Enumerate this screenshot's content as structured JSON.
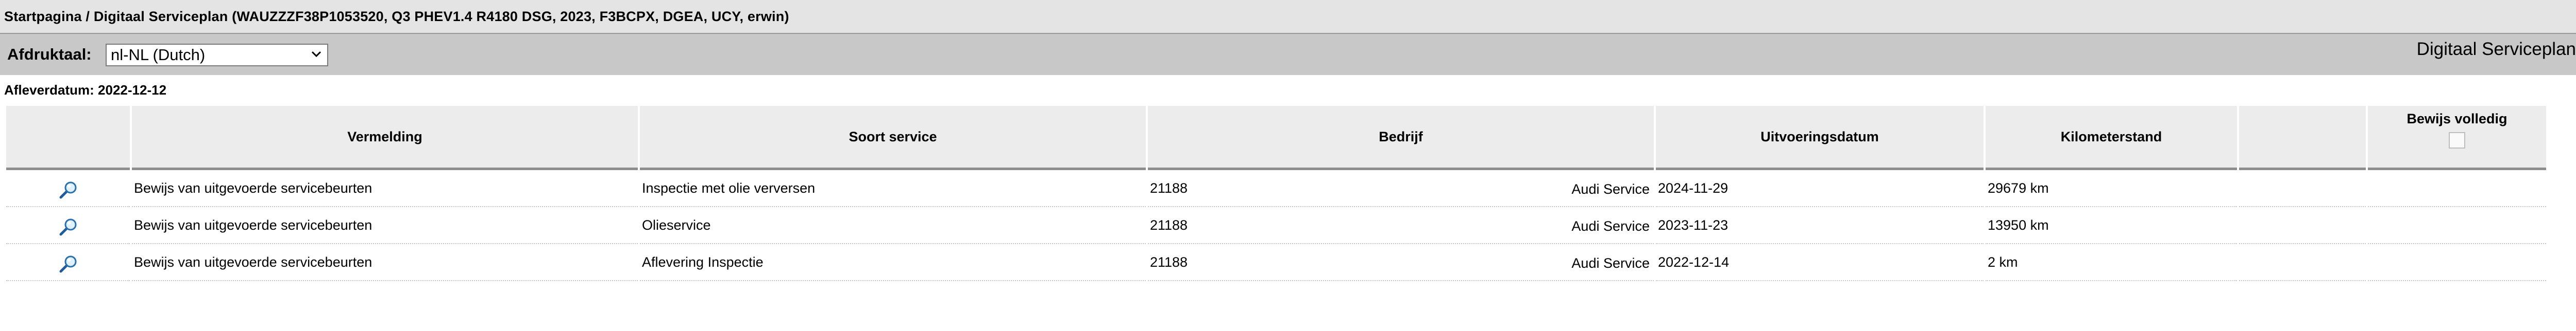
{
  "breadcrumb": "Startpagina / Digitaal Serviceplan (WAUZZZF38P1053520, Q3 PHEV1.4 R4180 DSG, 2023, F3BCPX, DGEA, UCY, erwin)",
  "toolbar": {
    "print_language_label": "Afdruktaal:",
    "print_language_value": "nl-NL (Dutch)",
    "title": "Digitaal Serviceplan"
  },
  "delivery_date": "Afleverdatum: 2022-12-12",
  "table": {
    "headers": {
      "description": "Vermelding",
      "service_type": "Soort service",
      "company": "Bedrijf",
      "date": "Uitvoeringsdatum",
      "mileage": "Kilometerstand",
      "proof": "Bewijs volledig"
    },
    "rows": [
      {
        "icon": "magnifier-icon",
        "description": "Bewijs van uitgevoerde servicebeurten",
        "service_type": "Inspectie met olie verversen",
        "company_code": "21188",
        "company_name": "Audi Service",
        "date": "2024-11-29",
        "mileage": "29679 km"
      },
      {
        "icon": "magnifier-icon",
        "description": "Bewijs van uitgevoerde servicebeurten",
        "service_type": "Olieservice",
        "company_code": "21188",
        "company_name": "Audi Service",
        "date": "2023-11-23",
        "mileage": "13950 km"
      },
      {
        "icon": "magnifier-icon",
        "description": "Bewijs van uitgevoerde servicebeurten",
        "service_type": "Aflevering Inspectie",
        "company_code": "21188",
        "company_name": "Audi Service",
        "date": "2022-12-14",
        "mileage": "2 km"
      }
    ]
  }
}
